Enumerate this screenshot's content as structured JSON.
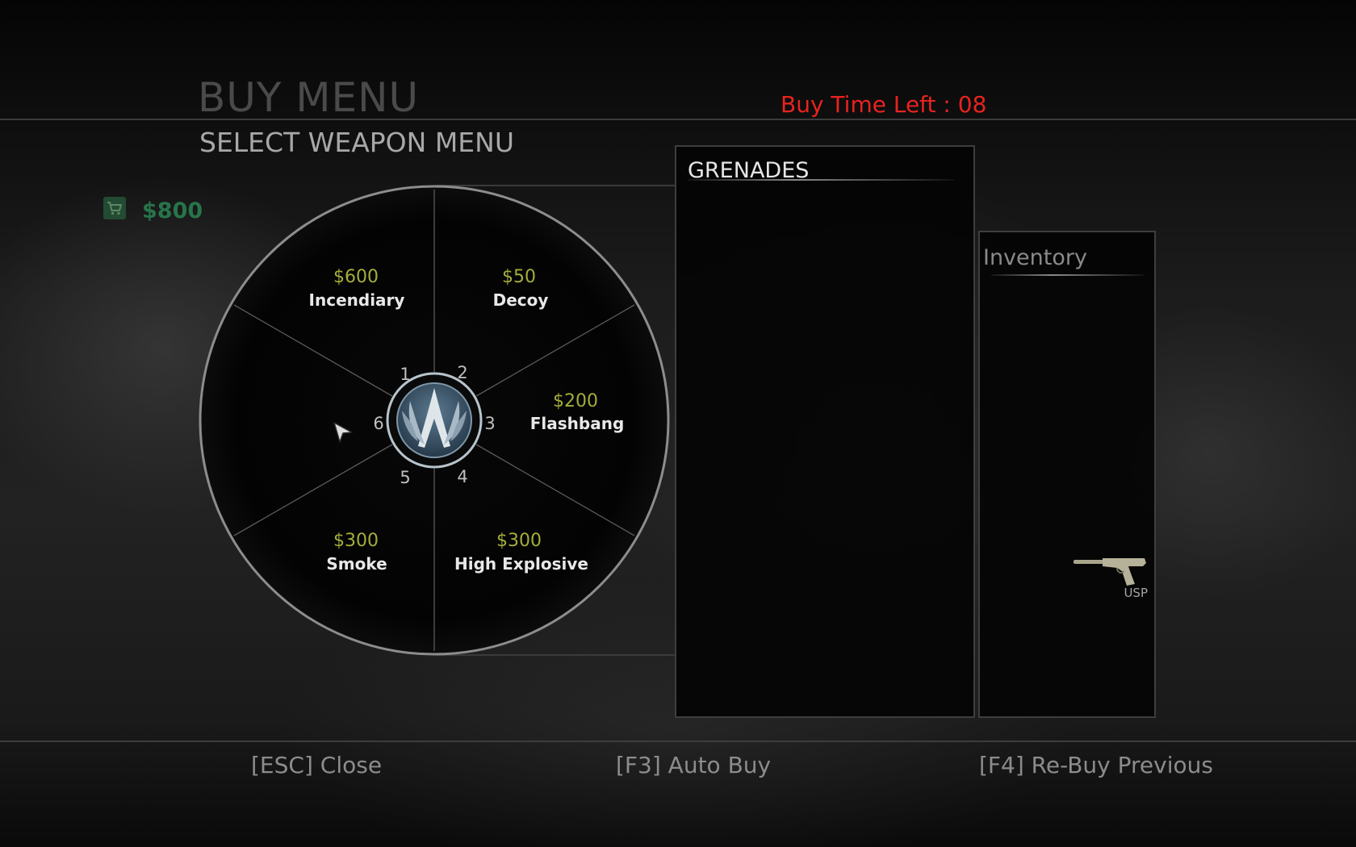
{
  "header": {
    "title": "BUY MENU",
    "subtitle": "SELECT WEAPON MENU",
    "buy_time": "Buy Time Left : 08"
  },
  "wallet": {
    "icon": "cart-icon",
    "amount": "$800"
  },
  "wheel": {
    "center_icon": "ct-emblem-icon",
    "slots": [
      {
        "key": "1",
        "name": "Incendiary",
        "price": "$600"
      },
      {
        "key": "2",
        "name": "Decoy",
        "price": "$50"
      },
      {
        "key": "3",
        "name": "Flashbang",
        "price": "$200"
      },
      {
        "key": "4",
        "name": "High Explosive",
        "price": "$300"
      },
      {
        "key": "5",
        "name": "Smoke",
        "price": "$300"
      },
      {
        "key": "6",
        "name": "",
        "price": ""
      }
    ],
    "colors": {
      "price": "#a4ad3a",
      "name": "#e8e8e8",
      "ring": "#8d8d8d"
    }
  },
  "grenades_panel": {
    "title": "GRENADES"
  },
  "inventory": {
    "title": "Inventory",
    "items": [
      {
        "name": "USP",
        "icon": "pistol-icon"
      }
    ]
  },
  "footer": {
    "close": "[ESC]  Close",
    "auto_buy": "[F3] Auto Buy",
    "rebuy": "[F4] Re-Buy Previous"
  }
}
